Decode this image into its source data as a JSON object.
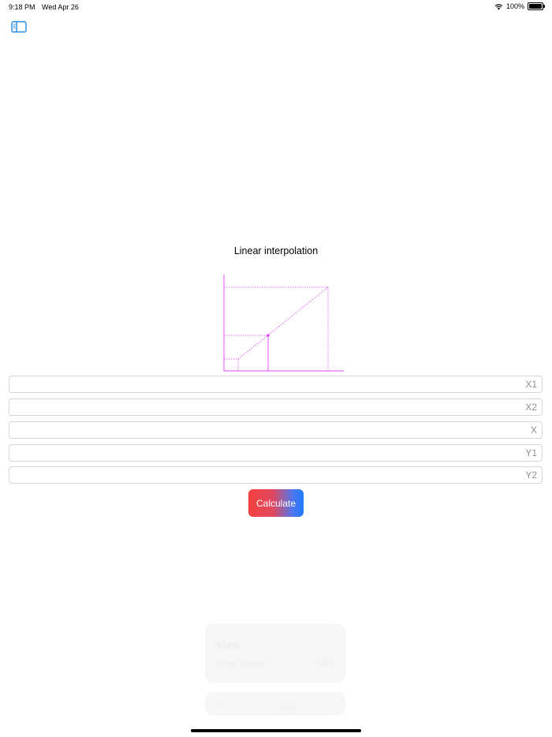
{
  "status_bar": {
    "time": "9:18 PM",
    "date": "Wed Apr 26",
    "battery": "100%"
  },
  "icons": {
    "sidebar_toggle": "sidebar-toggle-icon",
    "wifi": "wifi-icon",
    "battery": "battery-icon"
  },
  "title": "Linear interpolation",
  "fields": [
    {
      "placeholder": "X1",
      "value": ""
    },
    {
      "placeholder": "X2",
      "value": ""
    },
    {
      "placeholder": "X",
      "value": ""
    },
    {
      "placeholder": "Y1",
      "value": ""
    },
    {
      "placeholder": "Y2",
      "value": ""
    }
  ],
  "calculate_label": "Calculate",
  "ghost_menu": {
    "title": "View",
    "row_label": "Show Sidebar",
    "row_shortcut": "^⌘S",
    "bar_label": "View"
  },
  "colors": {
    "accent": "#1e88e5",
    "diagram": "#e040fb",
    "button_gradient_start": "#f5413f",
    "button_gradient_end": "#1f7bff"
  }
}
